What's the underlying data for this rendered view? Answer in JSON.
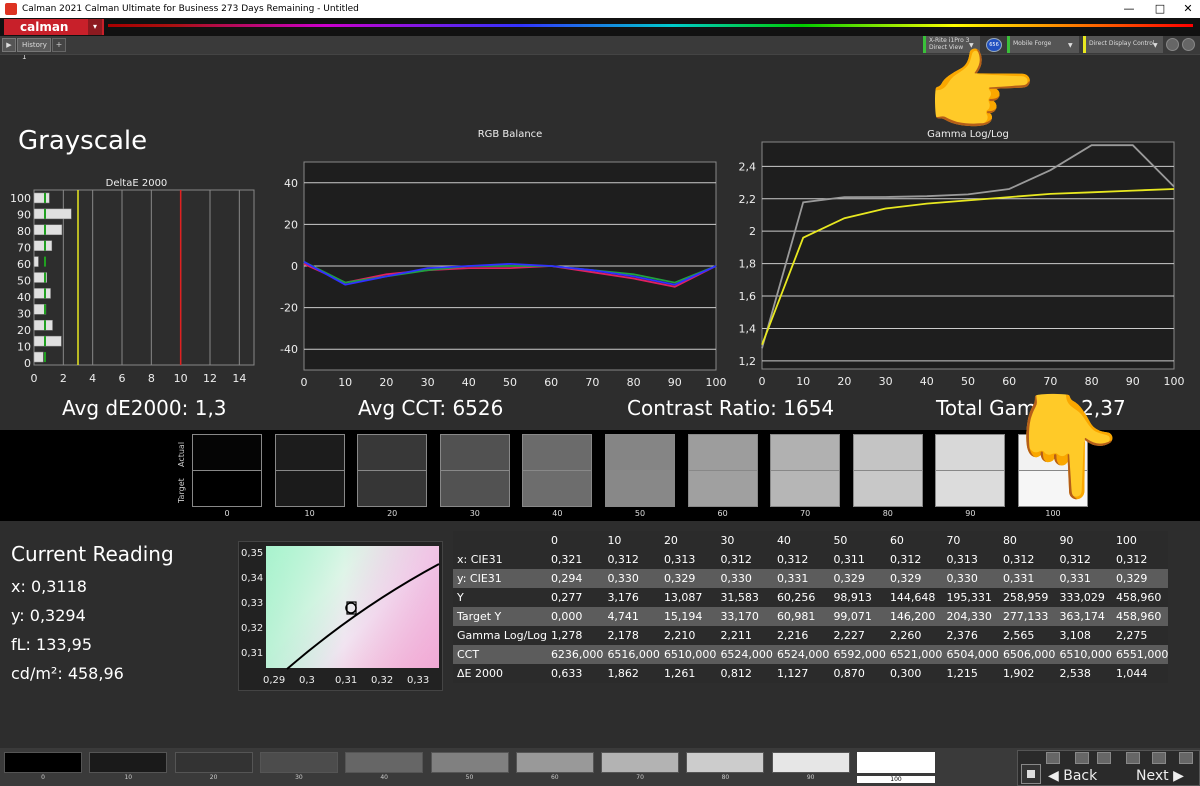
{
  "window": {
    "title": "Calman 2021 Calman Ultimate for Business 273 Days Remaining  - Untitled",
    "minimize": "—",
    "maximize": "□",
    "close": "✕"
  },
  "app": {
    "logo": "calman"
  },
  "tabs": [
    {
      "label": "History 1"
    }
  ],
  "devices": {
    "meter": {
      "line1": "X-Rite i1Pro 3",
      "line2": "Direct View",
      "accent": "#3ac03a"
    },
    "meter_badge": "656",
    "source": {
      "label": "Mobile Forge",
      "accent": "#3ac03a"
    },
    "display": {
      "label": "Direct Display Control",
      "accent": "#e8e820"
    }
  },
  "page_title": "Grayscale",
  "stats": {
    "avg_de": "Avg dE2000: 1,3",
    "avg_cct": "Avg CCT: 6526",
    "contrast": "Contrast Ratio: 1654",
    "gamma": "Total Gamma: 2,37"
  },
  "deltae_chart": {
    "title": "DeltaE 2000",
    "y_ticks": [
      "100",
      "90",
      "80",
      "70",
      "60",
      "50",
      "40",
      "30",
      "20",
      "10",
      "0"
    ],
    "x_ticks": [
      "0",
      "2",
      "4",
      "6",
      "8",
      "10",
      "12",
      "14"
    ],
    "levels": [
      0,
      10,
      20,
      30,
      40,
      50,
      60,
      70,
      80,
      90,
      100
    ],
    "values": [
      0.633,
      1.862,
      1.261,
      0.812,
      1.127,
      0.87,
      0.3,
      1.215,
      1.902,
      2.538,
      1.044
    ],
    "xlim": [
      0,
      15
    ],
    "thresholds": [
      {
        "value": 3,
        "color": "#e8e820"
      },
      {
        "value": 10,
        "color": "#e02020"
      }
    ]
  },
  "rgb_chart": {
    "title": "RGB Balance",
    "y_ticks": [
      "40",
      "20",
      "0",
      "-20",
      "-40"
    ],
    "x_ticks": [
      "0",
      "10",
      "20",
      "30",
      "40",
      "50",
      "60",
      "70",
      "80",
      "90",
      "100"
    ]
  },
  "gamma_chart": {
    "title": "Gamma Log/Log",
    "y_ticks": [
      "2,4",
      "2,2",
      "2",
      "1,8",
      "1,6",
      "1,4",
      "1,2"
    ],
    "x_ticks": [
      "0",
      "10",
      "20",
      "30",
      "40",
      "50",
      "60",
      "70",
      "80",
      "90",
      "100"
    ]
  },
  "chart_data": [
    {
      "type": "bar",
      "title": "DeltaE 2000",
      "categories": [
        "0",
        "10",
        "20",
        "30",
        "40",
        "50",
        "60",
        "70",
        "80",
        "90",
        "100"
      ],
      "values": [
        0.633,
        1.862,
        1.261,
        0.812,
        1.127,
        0.87,
        0.3,
        1.215,
        1.902,
        2.538,
        1.044
      ],
      "xlim": [
        0,
        15
      ],
      "orientation": "horizontal"
    },
    {
      "type": "line",
      "title": "RGB Balance",
      "x": [
        0,
        10,
        20,
        30,
        40,
        50,
        60,
        70,
        80,
        90,
        100
      ],
      "ylim": [
        -50,
        50
      ],
      "series": [
        {
          "color": "#e02060",
          "values": [
            1,
            -8,
            -4,
            -2,
            -1,
            -1,
            0,
            -3,
            -6,
            -10,
            0
          ]
        },
        {
          "color": "#20a040",
          "values": [
            2,
            -8,
            -5,
            -2,
            0,
            0,
            0,
            -2,
            -4,
            -8,
            0
          ]
        },
        {
          "color": "#3030ff",
          "values": [
            2,
            -9,
            -5,
            -1,
            0,
            1,
            0,
            -2,
            -5,
            -9,
            0
          ]
        }
      ]
    },
    {
      "type": "line",
      "title": "Gamma Log/Log",
      "x": [
        0,
        10,
        20,
        30,
        40,
        50,
        60,
        70,
        80,
        90,
        100
      ],
      "ylim": [
        1.15,
        2.55
      ],
      "series": [
        {
          "color": "#9a9a9a",
          "values": [
            1.278,
            2.178,
            2.21,
            2.211,
            2.216,
            2.227,
            2.26,
            2.376,
            2.565,
            3.108,
            2.275
          ]
        },
        {
          "color": "#e8e820",
          "values": [
            1.3,
            1.96,
            2.08,
            2.14,
            2.17,
            2.19,
            2.21,
            2.23,
            2.24,
            2.25,
            2.26
          ]
        }
      ]
    }
  ],
  "swatches": {
    "row_labels": {
      "actual": "Actual",
      "target": "Target"
    },
    "items": [
      {
        "label": "0",
        "actual": "#050505",
        "target": "#000000"
      },
      {
        "label": "10",
        "actual": "#1c1c1c",
        "target": "#1b1b1b"
      },
      {
        "label": "20",
        "actual": "#383838",
        "target": "#363636"
      },
      {
        "label": "30",
        "actual": "#515151",
        "target": "#525252"
      },
      {
        "label": "40",
        "actual": "#6b6b6b",
        "target": "#6d6d6d"
      },
      {
        "label": "50",
        "actual": "#858585",
        "target": "#888888"
      },
      {
        "label": "60",
        "actual": "#9d9d9d",
        "target": "#a0a0a0"
      },
      {
        "label": "70",
        "actual": "#b1b1b1",
        "target": "#b6b6b6"
      },
      {
        "label": "80",
        "actual": "#c4c4c4",
        "target": "#c8c8c8"
      },
      {
        "label": "90",
        "actual": "#d8d8d8",
        "target": "#dcdcdc"
      },
      {
        "label": "100",
        "actual": "#f2f2f2",
        "target": "#f6f6f6"
      }
    ]
  },
  "current_reading": {
    "title": "Current Reading",
    "x": "x: 0,3118",
    "y": "y: 0,3294",
    "fl": "fL: 133,95",
    "cdm2": "cd/m²: 458,96"
  },
  "cie_chart": {
    "y_ticks": [
      "0,35",
      "0,34",
      "0,33",
      "0,32",
      "0,31"
    ],
    "x_ticks": [
      "0,29",
      "0,3",
      "0,31",
      "0,32",
      "0,33"
    ]
  },
  "data_table": {
    "columns": [
      "",
      "0",
      "10",
      "20",
      "30",
      "40",
      "50",
      "60",
      "70",
      "80",
      "90",
      "100"
    ],
    "rows": [
      [
        "x: CIE31",
        "0,321",
        "0,312",
        "0,313",
        "0,312",
        "0,312",
        "0,311",
        "0,312",
        "0,313",
        "0,312",
        "0,312",
        "0,312"
      ],
      [
        "y: CIE31",
        "0,294",
        "0,330",
        "0,329",
        "0,330",
        "0,331",
        "0,329",
        "0,329",
        "0,330",
        "0,331",
        "0,331",
        "0,329"
      ],
      [
        "Y",
        "0,277",
        "3,176",
        "13,087",
        "31,583",
        "60,256",
        "98,913",
        "144,648",
        "195,331",
        "258,959",
        "333,029",
        "458,960"
      ],
      [
        "Target Y",
        "0,000",
        "4,741",
        "15,194",
        "33,170",
        "60,981",
        "99,071",
        "146,200",
        "204,330",
        "277,133",
        "363,174",
        "458,960"
      ],
      [
        "Gamma Log/Log",
        "1,278",
        "2,178",
        "2,210",
        "2,211",
        "2,216",
        "2,227",
        "2,260",
        "2,376",
        "2,565",
        "3,108",
        "2,275"
      ],
      [
        "CCT",
        "6236,000",
        "6516,000",
        "6510,000",
        "6524,000",
        "6524,000",
        "6592,000",
        "6521,000",
        "6504,000",
        "6506,000",
        "6510,000",
        "6551,000"
      ],
      [
        "ΔE 2000",
        "0,633",
        "1,862",
        "1,261",
        "0,812",
        "1,127",
        "0,870",
        "0,300",
        "1,215",
        "1,902",
        "2,538",
        "1,044"
      ]
    ]
  },
  "bottom_swatches": [
    {
      "label": "0",
      "color": "#000000"
    },
    {
      "label": "10",
      "color": "#1a1a1a"
    },
    {
      "label": "20",
      "color": "#333333"
    },
    {
      "label": "30",
      "color": "#4c4c4c"
    },
    {
      "label": "40",
      "color": "#666666"
    },
    {
      "label": "50",
      "color": "#808080"
    },
    {
      "label": "60",
      "color": "#999999"
    },
    {
      "label": "70",
      "color": "#b3b3b3"
    },
    {
      "label": "80",
      "color": "#cccccc"
    },
    {
      "label": "90",
      "color": "#e6e6e6"
    },
    {
      "label": "100",
      "color": "#ffffff",
      "selected": true
    }
  ],
  "nav": {
    "back": "Back",
    "next": "Next"
  }
}
